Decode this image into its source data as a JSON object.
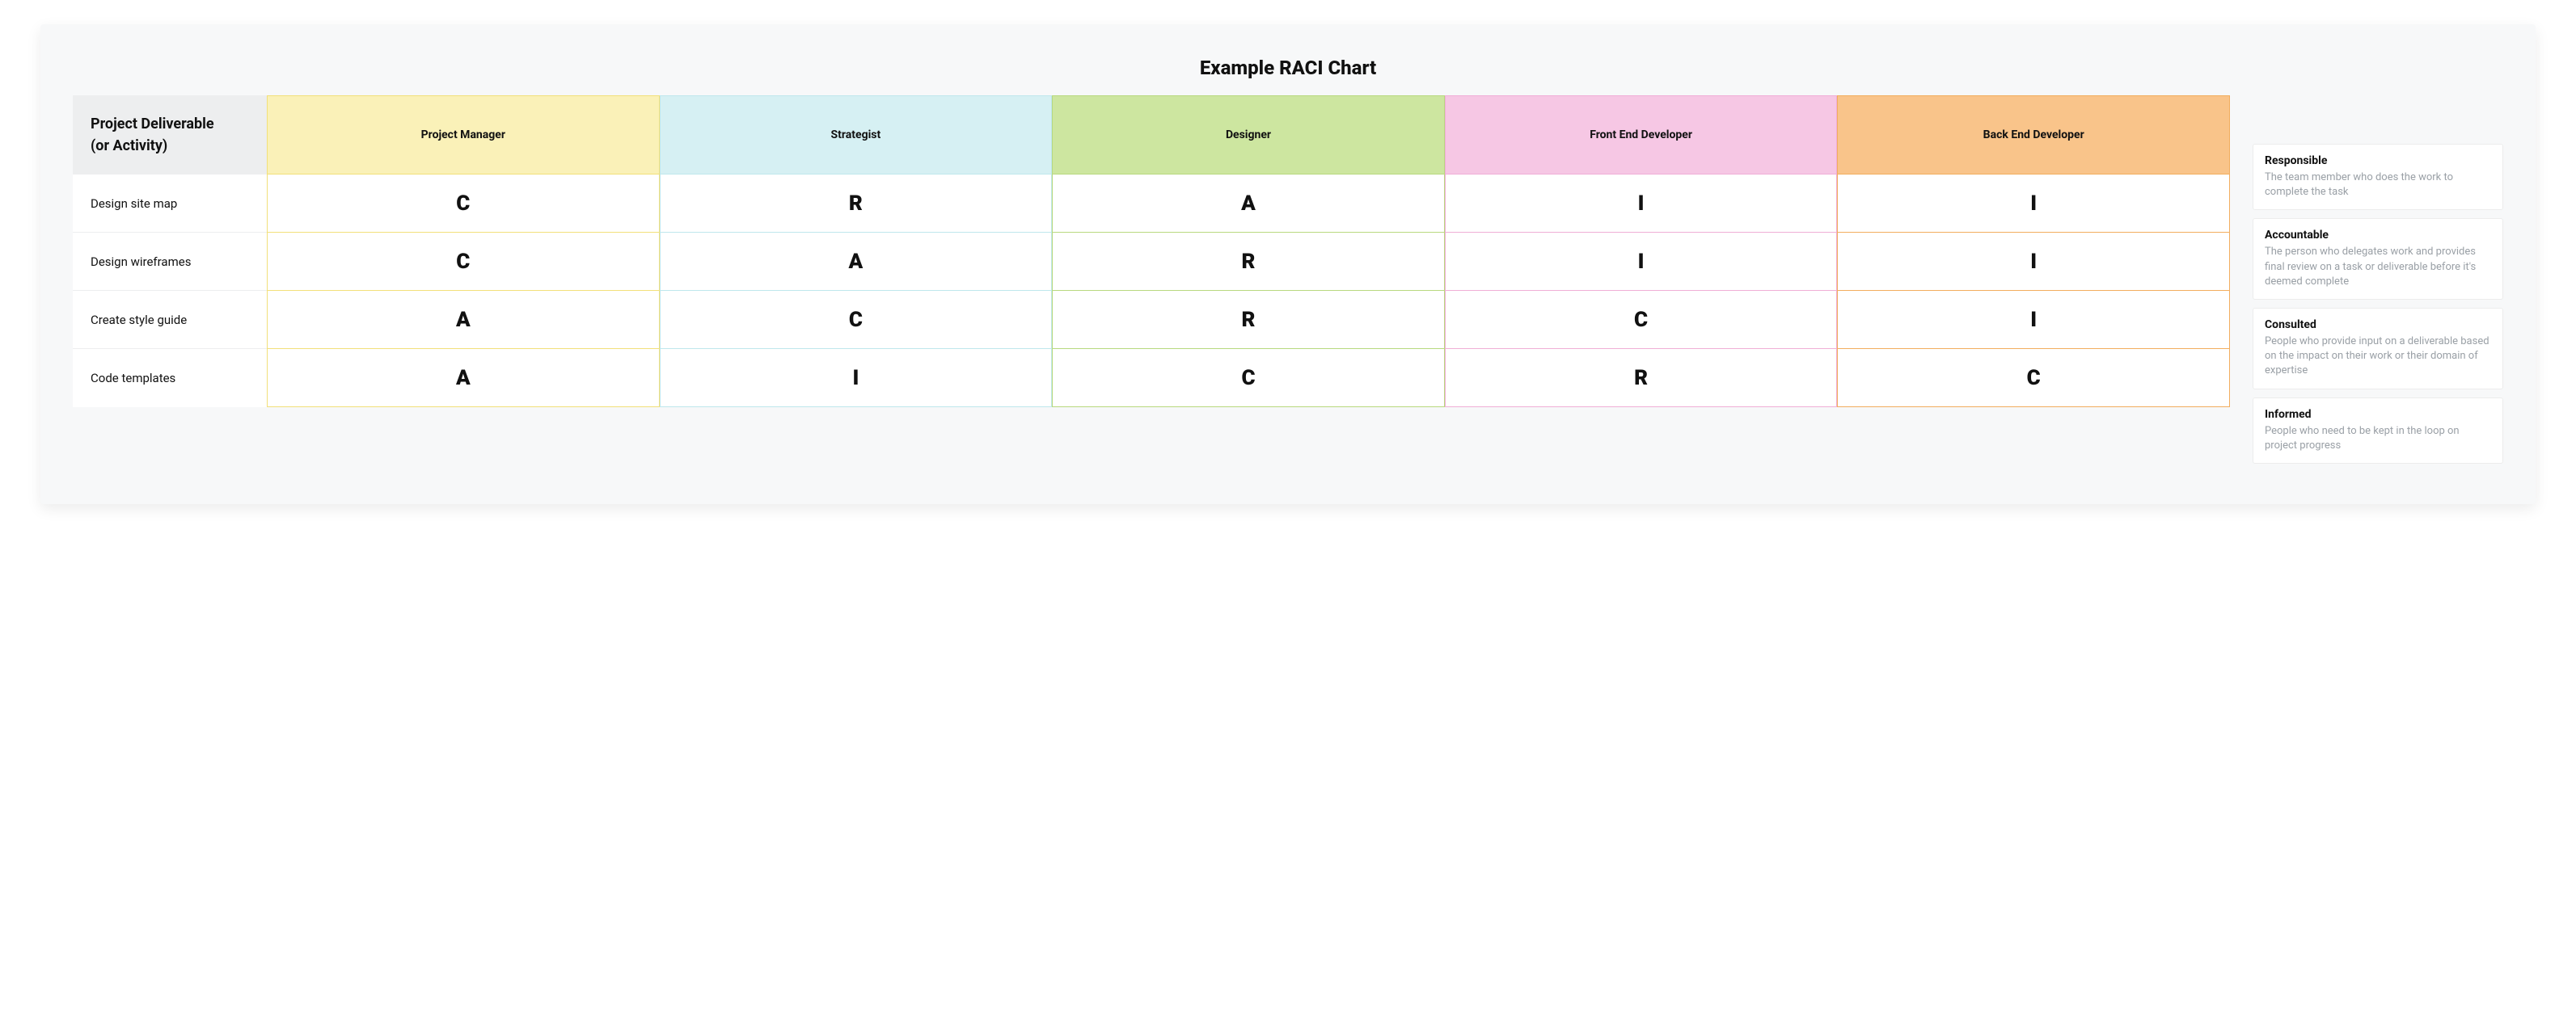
{
  "title": "Example RACI Chart",
  "corner_label_line1": "Project Deliverable",
  "corner_label_line2": "(or Activity)",
  "roles": [
    {
      "name": "Project Manager",
      "bg": "#faf1b8",
      "border": "#f2e07a"
    },
    {
      "name": "Strategist",
      "bg": "#d6f0f3",
      "border": "#bfe7ec"
    },
    {
      "name": "Designer",
      "bg": "#cde6a0",
      "border": "#b8d97f"
    },
    {
      "name": "Front End Developer",
      "bg": "#f6c7e4",
      "border": "#f0aed6"
    },
    {
      "name": "Back End Developer",
      "bg": "#f9c48a",
      "border": "#f2ad5e"
    }
  ],
  "rows": [
    {
      "label": "Design site map",
      "values": [
        "C",
        "R",
        "A",
        "I",
        "I"
      ]
    },
    {
      "label": "Design wireframes",
      "values": [
        "C",
        "A",
        "R",
        "I",
        "I"
      ]
    },
    {
      "label": "Create style guide",
      "values": [
        "A",
        "C",
        "R",
        "C",
        "I"
      ]
    },
    {
      "label": "Code templates",
      "values": [
        "A",
        "I",
        "C",
        "R",
        "C"
      ]
    }
  ],
  "legend": [
    {
      "term": "Responsible",
      "def": "The team member who does the work to complete the task"
    },
    {
      "term": "Accountable",
      "def": "The person who delegates work and provides final review on a task or deliverable before it's deemed complete"
    },
    {
      "term": "Consulted",
      "def": "People who provide input on a deliverable based on the impact on their work or their domain of expertise"
    },
    {
      "term": "Informed",
      "def": "People who need to be kept in the loop on project progress"
    }
  ],
  "chart_data": {
    "type": "table",
    "title": "Example RACI Chart",
    "columns": [
      "Project Manager",
      "Strategist",
      "Designer",
      "Front End Developer",
      "Back End Developer"
    ],
    "rows": [
      "Design site map",
      "Design wireframes",
      "Create style guide",
      "Code templates"
    ],
    "values": [
      [
        "C",
        "R",
        "A",
        "I",
        "I"
      ],
      [
        "C",
        "A",
        "R",
        "I",
        "I"
      ],
      [
        "A",
        "C",
        "R",
        "C",
        "I"
      ],
      [
        "A",
        "I",
        "C",
        "R",
        "C"
      ]
    ],
    "legend": {
      "R": "Responsible",
      "A": "Accountable",
      "C": "Consulted",
      "I": "Informed"
    }
  }
}
